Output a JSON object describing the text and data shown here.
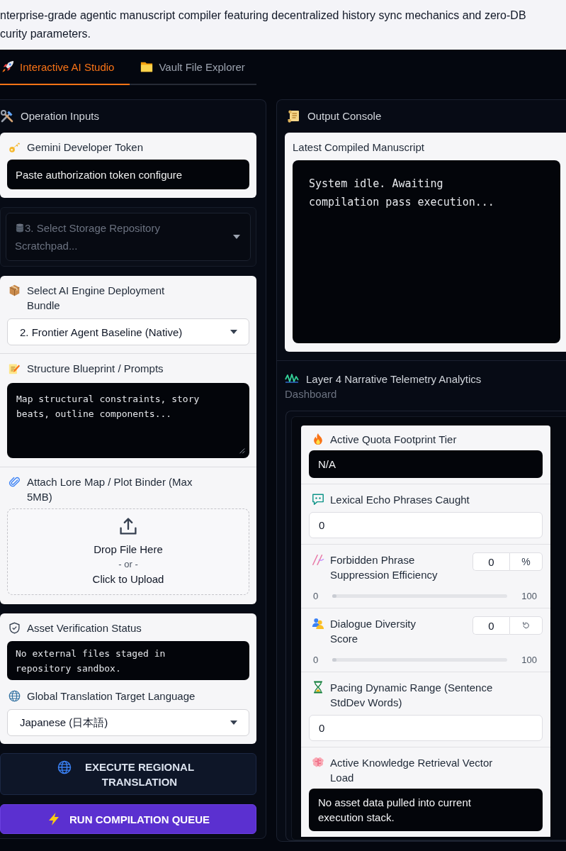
{
  "header": {
    "description_lines": [
      "nterprise-grade agentic manuscript compiler featuring decentralized history sync mechanics and zero-DB",
      "curity parameters."
    ]
  },
  "tabs": [
    {
      "label": "Interactive AI Studio",
      "selected": true
    },
    {
      "label": "Vault File Explorer",
      "selected": false
    }
  ],
  "inputs_panel": {
    "title": "Operation Inputs",
    "groups": [
      {
        "fields": [
          {
            "kind": "token",
            "label": "Gemini Developer Token",
            "placeholder": "Paste authorization token configure"
          }
        ]
      },
      {
        "fields": [
          {
            "kind": "select",
            "label": "3. Select Storage Repository",
            "value": "Scratchpad...",
            "disabled": true
          }
        ]
      },
      {
        "fields": [
          {
            "kind": "select",
            "label": "Select AI Engine Deployment Bundle",
            "value": "2. Frontier Agent Baseline (Native)",
            "disabled": false
          },
          {
            "kind": "textarea",
            "label": "Structure Blueprint / Prompts",
            "placeholder": "Map structural constraints, story beats, outline components..."
          },
          {
            "kind": "upload",
            "label": "Attach Lore Map / Plot Binder (Max 5MB)",
            "drop_text": "Drop File Here",
            "separator": "- or -",
            "click_text": "Click to Upload"
          }
        ]
      },
      {
        "fields": [
          {
            "kind": "status",
            "label": "Asset Verification Status",
            "message": "No external files staged in repository sandbox."
          },
          {
            "kind": "select",
            "label": "Global Translation Target Language",
            "value": "Japanese (日本語)",
            "disabled": false
          }
        ]
      }
    ],
    "buttons": [
      {
        "kind": "secondary",
        "label": "EXECUTE REGIONAL TRANSLATION"
      },
      {
        "kind": "primary",
        "label": "RUN COMPILATION QUEUE"
      }
    ]
  },
  "output_panel": {
    "title": "Output Console",
    "card_label": "Latest Compiled Manuscript",
    "console_text": "System idle. Awaiting compilation pass execution..."
  },
  "telemetry": {
    "title": "Layer 4 Narrative Telemetry Analytics",
    "subtitle": "Dashboard",
    "metrics": [
      {
        "kind": "readout",
        "label": "Active Quota Footprint Tier",
        "value": "N/A"
      },
      {
        "kind": "number",
        "label": "Lexical Echo Phrases Caught",
        "value": "0"
      },
      {
        "kind": "slider",
        "label": "Forbidden Phrase Suppression Efficiency",
        "value": "0",
        "unit": "%",
        "min": "0",
        "max": "100",
        "level": 0
      },
      {
        "kind": "slider",
        "label": "Dialogue Diversity Score",
        "value": "0",
        "min": "0",
        "max": "100",
        "level": 0
      },
      {
        "kind": "number",
        "label": "Pacing Dynamic Range (Sentence StdDev Words)",
        "value": "0"
      },
      {
        "kind": "readout",
        "label": "Active Knowledge Retrieval Vector Load",
        "value": "No asset data pulled into current execution stack."
      }
    ]
  }
}
